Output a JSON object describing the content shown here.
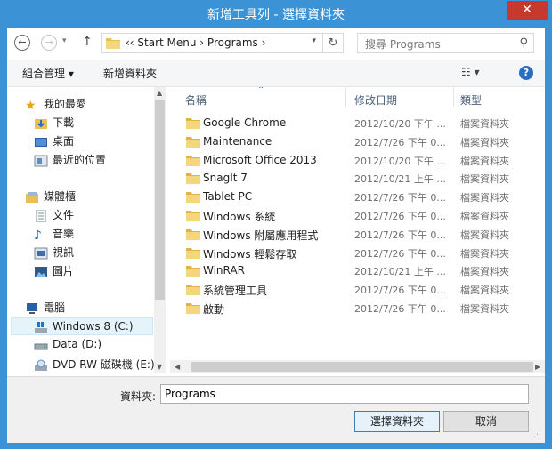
{
  "window": {
    "title": "新增工具列 - 選擇資料夾",
    "close": "✕"
  },
  "address": {
    "back": "←",
    "forward": "→",
    "up": "↑",
    "path": "‹‹ Start Menu  ›  Programs  ›",
    "dropdown": "▾",
    "refresh": "↻"
  },
  "search": {
    "placeholder": "搜尋 Programs",
    "icon": "⚲"
  },
  "toolbar": {
    "organize": "組合管理 ▾",
    "new_folder": "新增資料夾",
    "view": "☷ ▾",
    "help": "?"
  },
  "nav": {
    "favorites_label": "我的最愛",
    "favorites": [
      "下載",
      "桌面",
      "最近的位置"
    ],
    "libraries_label": "媒體櫃",
    "libraries": [
      "文件",
      "音樂",
      "視訊",
      "圖片"
    ],
    "computer_label": "電腦",
    "drives": [
      "Windows 8 (C:)",
      "Data (D:)",
      "DVD RW 磁碟機 (E:)"
    ]
  },
  "columns": {
    "name": "名稱",
    "date": "修改日期",
    "type": "類型",
    "sort_arrow": "⌃"
  },
  "files": [
    {
      "name": "Google Chrome",
      "date": "2012/10/20 下午 ...",
      "type": "檔案資料夾"
    },
    {
      "name": "Maintenance",
      "date": "2012/7/26 下午 0...",
      "type": "檔案資料夾"
    },
    {
      "name": "Microsoft Office 2013",
      "date": "2012/10/20 下午 ...",
      "type": "檔案資料夾"
    },
    {
      "name": "SnagIt 7",
      "date": "2012/10/21 上午 ...",
      "type": "檔案資料夾"
    },
    {
      "name": "Tablet PC",
      "date": "2012/7/26 下午 0...",
      "type": "檔案資料夾"
    },
    {
      "name": "Windows 系統",
      "date": "2012/7/26 下午 0...",
      "type": "檔案資料夾"
    },
    {
      "name": "Windows 附屬應用程式",
      "date": "2012/7/26 下午 0...",
      "type": "檔案資料夾"
    },
    {
      "name": "Windows 輕鬆存取",
      "date": "2012/7/26 下午 0...",
      "type": "檔案資料夾"
    },
    {
      "name": "WinRAR",
      "date": "2012/10/21 上午 ...",
      "type": "檔案資料夾"
    },
    {
      "name": "系統管理工具",
      "date": "2012/7/26 下午 0...",
      "type": "檔案資料夾"
    },
    {
      "name": "啟動",
      "date": "2012/7/26 下午 0...",
      "type": "檔案資料夾"
    }
  ],
  "bottom": {
    "folder_label": "資料夾:",
    "folder_value": "Programs",
    "select_button": "選擇資料夾",
    "cancel_button": "取消"
  },
  "colors": {
    "title_bar": "#3b93d6",
    "close": "#c7392c",
    "folder": "#e8c05a",
    "accent": "#2a6ec2"
  }
}
